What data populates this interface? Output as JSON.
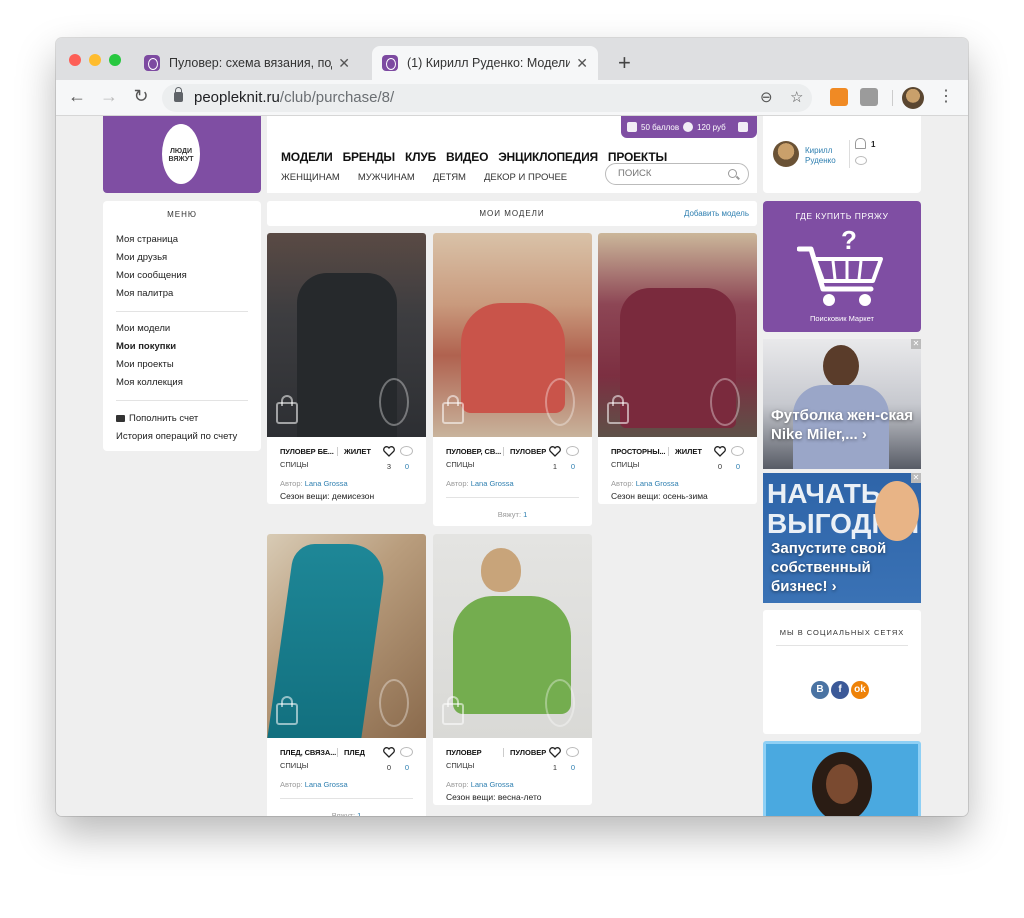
{
  "browser": {
    "tabs": [
      {
        "title": "Пуловер: схема вязания, под",
        "active": false
      },
      {
        "title": "(1) Кирилл Руденко: Модели",
        "active": true
      }
    ],
    "url_host": "peopleknit.ru",
    "url_path": "/club/purchase/8/"
  },
  "site": {
    "logo_text": "ЛЮДИ ВЯЖУТ",
    "promo": {
      "points": "50 баллов",
      "balance": "120 руб"
    },
    "main_nav": [
      "МОДЕЛИ",
      "БРЕНДЫ",
      "КЛУБ",
      "ВИДЕО",
      "ЭНЦИКЛОПЕДИЯ",
      "ПРОЕКТЫ"
    ],
    "sub_nav": [
      "ЖЕНЩИНАМ",
      "МУЖЧИНАМ",
      "ДЕТЯМ",
      "ДЕКОР И ПРОЧЕЕ"
    ],
    "search_placeholder": "ПОИСК",
    "user": {
      "first_name": "Кирилл",
      "last_name": "Руденко",
      "notifications": "1"
    }
  },
  "menu": {
    "title": "МЕНЮ",
    "group1": [
      "Моя страница",
      "Мои друзья",
      "Мои сообщения",
      "Моя палитра"
    ],
    "group2": [
      "Мои модели",
      "Мои покупки",
      "Мои проекты",
      "Моя коллекция"
    ],
    "group3": [
      "Пополнить счет",
      "История операций по счету"
    ],
    "active": "Мои покупки"
  },
  "models": {
    "title": "МОИ МОДЕЛИ",
    "add_label": "Добавить модель",
    "author_label": "Автор:",
    "season_label": "Сезон вещи:",
    "knit_label": "Вяжут:",
    "cards": [
      {
        "name": "ПУЛОВЕР БЕ...",
        "type": "ЖИЛЕТ",
        "tool": "СПИЦЫ",
        "likes": "3",
        "comments": "0",
        "author": "Lana Grossa",
        "season": "демисезон",
        "knit": ""
      },
      {
        "name": "ПУЛОВЕР, СВ...",
        "type": "ПУЛОВЕР",
        "tool": "СПИЦЫ",
        "likes": "1",
        "comments": "0",
        "author": "Lana Grossa",
        "season": "",
        "knit": "1"
      },
      {
        "name": "ПРОСТОРНЫ...",
        "type": "ЖИЛЕТ",
        "tool": "СПИЦЫ",
        "likes": "0",
        "comments": "0",
        "author": "Lana Grossa",
        "season": "осень-зима",
        "knit": ""
      },
      {
        "name": "ПЛЕД, СВЯЗА...",
        "type": "ПЛЕД",
        "tool": "СПИЦЫ",
        "likes": "0",
        "comments": "0",
        "author": "Lana Grossa",
        "season": "",
        "knit": "1"
      },
      {
        "name": "ПУЛОВЕР",
        "type": "ПУЛОВЕР",
        "tool": "СПИЦЫ",
        "likes": "1",
        "comments": "0",
        "author": "Lana Grossa",
        "season": "весна-лето",
        "knit": ""
      }
    ]
  },
  "sidebar": {
    "yarn_title": "ГДЕ КУПИТЬ ПРЯЖУ",
    "yarn_caption": "Поисковик Маркет",
    "ad1_text": "Футболка жен-ская Nike Miler,... ›",
    "ad2_banner": "НАЧАТЬ ВЫГОДНЫЙ",
    "ad2_text": "Запустите свой собственный бизнес! ›",
    "social_title": "МЫ В СОЦИАЛЬНЫХ СЕТЯХ",
    "social": [
      "В",
      "f",
      "ok"
    ]
  },
  "colors": {
    "brand": "#7f4ea3",
    "link": "#2e7fb0"
  }
}
